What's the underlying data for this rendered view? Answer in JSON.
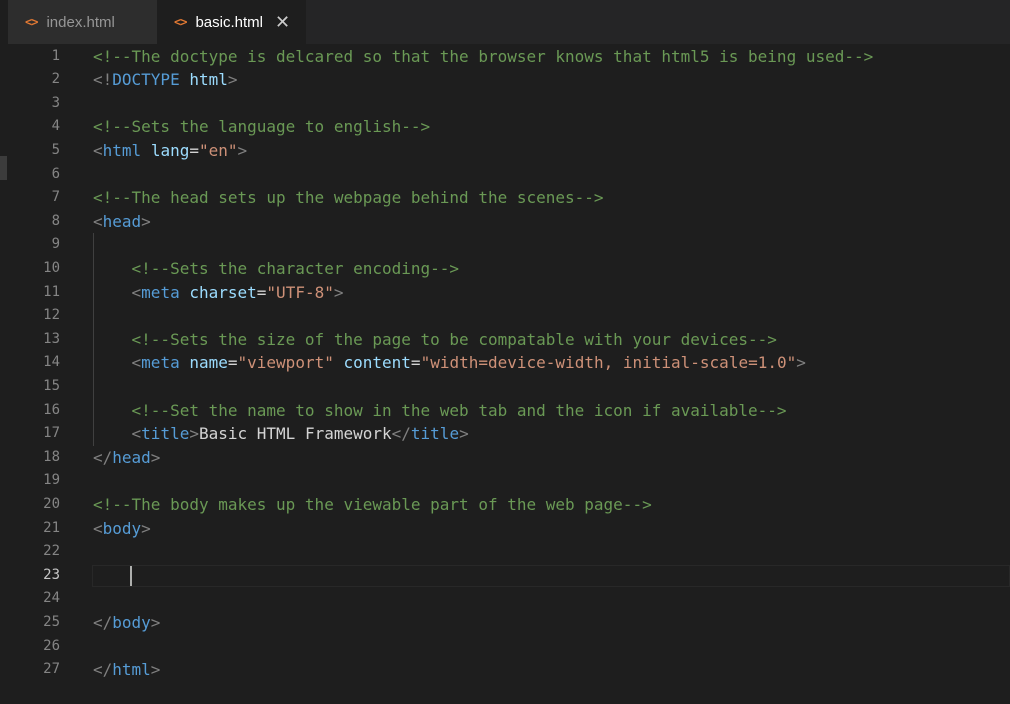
{
  "tabs": [
    {
      "label": "index.html",
      "icon": "html-file-icon",
      "active": false
    },
    {
      "label": "basic.html",
      "icon": "html-file-icon",
      "active": true,
      "close_glyph": "✕"
    }
  ],
  "tab_icon_glyph": "<>",
  "editor": {
    "current_line": 23,
    "line_numbers": [
      "1",
      "2",
      "3",
      "4",
      "5",
      "6",
      "7",
      "8",
      "9",
      "10",
      "11",
      "12",
      "13",
      "14",
      "15",
      "16",
      "17",
      "18",
      "19",
      "20",
      "21",
      "22",
      "23",
      "24",
      "25",
      "26",
      "27"
    ],
    "lines": [
      [
        {
          "t": "<!--The doctype is delcared so that the browser knows that html5 is being used-->",
          "c": "comment"
        }
      ],
      [
        {
          "t": "<!",
          "c": "punct"
        },
        {
          "t": "DOCTYPE",
          "c": "tag"
        },
        {
          "t": " ",
          "c": "text"
        },
        {
          "t": "html",
          "c": "attr"
        },
        {
          "t": ">",
          "c": "punct"
        }
      ],
      [],
      [
        {
          "t": "<!--Sets the language to english-->",
          "c": "comment"
        }
      ],
      [
        {
          "t": "<",
          "c": "punct"
        },
        {
          "t": "html",
          "c": "tag"
        },
        {
          "t": " ",
          "c": "text"
        },
        {
          "t": "lang",
          "c": "attr"
        },
        {
          "t": "=",
          "c": "text"
        },
        {
          "t": "\"en\"",
          "c": "str"
        },
        {
          "t": ">",
          "c": "punct"
        }
      ],
      [],
      [
        {
          "t": "<!--The head sets up the webpage behind the scenes-->",
          "c": "comment"
        }
      ],
      [
        {
          "t": "<",
          "c": "punct"
        },
        {
          "t": "head",
          "c": "tag"
        },
        {
          "t": ">",
          "c": "punct"
        }
      ],
      [],
      [
        {
          "t": "    ",
          "c": "text"
        },
        {
          "t": "<!--Sets the character encoding-->",
          "c": "comment"
        }
      ],
      [
        {
          "t": "    ",
          "c": "text"
        },
        {
          "t": "<",
          "c": "punct"
        },
        {
          "t": "meta",
          "c": "tag"
        },
        {
          "t": " ",
          "c": "text"
        },
        {
          "t": "charset",
          "c": "attr"
        },
        {
          "t": "=",
          "c": "text"
        },
        {
          "t": "\"UTF-8\"",
          "c": "str"
        },
        {
          "t": ">",
          "c": "punct"
        }
      ],
      [],
      [
        {
          "t": "    ",
          "c": "text"
        },
        {
          "t": "<!--Sets the size of the page to be compatable with your devices-->",
          "c": "comment"
        }
      ],
      [
        {
          "t": "    ",
          "c": "text"
        },
        {
          "t": "<",
          "c": "punct"
        },
        {
          "t": "meta",
          "c": "tag"
        },
        {
          "t": " ",
          "c": "text"
        },
        {
          "t": "name",
          "c": "attr"
        },
        {
          "t": "=",
          "c": "text"
        },
        {
          "t": "\"viewport\"",
          "c": "str"
        },
        {
          "t": " ",
          "c": "text"
        },
        {
          "t": "content",
          "c": "attr"
        },
        {
          "t": "=",
          "c": "text"
        },
        {
          "t": "\"width=device-width, initial-scale=1.0\"",
          "c": "str"
        },
        {
          "t": ">",
          "c": "punct"
        }
      ],
      [],
      [
        {
          "t": "    ",
          "c": "text"
        },
        {
          "t": "<!--Set the name to show in the web tab and the icon if available-->",
          "c": "comment"
        }
      ],
      [
        {
          "t": "    ",
          "c": "text"
        },
        {
          "t": "<",
          "c": "punct"
        },
        {
          "t": "title",
          "c": "tag"
        },
        {
          "t": ">",
          "c": "punct"
        },
        {
          "t": "Basic HTML Framework",
          "c": "text"
        },
        {
          "t": "</",
          "c": "punct"
        },
        {
          "t": "title",
          "c": "tag"
        },
        {
          "t": ">",
          "c": "punct"
        }
      ],
      [
        {
          "t": "</",
          "c": "punct"
        },
        {
          "t": "head",
          "c": "tag"
        },
        {
          "t": ">",
          "c": "punct"
        }
      ],
      [],
      [
        {
          "t": "<!--The body makes up the viewable part of the web page-->",
          "c": "comment"
        }
      ],
      [
        {
          "t": "<",
          "c": "punct"
        },
        {
          "t": "body",
          "c": "tag"
        },
        {
          "t": ">",
          "c": "punct"
        }
      ],
      [],
      [],
      [],
      [
        {
          "t": "</",
          "c": "punct"
        },
        {
          "t": "body",
          "c": "tag"
        },
        {
          "t": ">",
          "c": "punct"
        }
      ],
      [],
      [
        {
          "t": "</",
          "c": "punct"
        },
        {
          "t": "html",
          "c": "tag"
        },
        {
          "t": ">",
          "c": "punct"
        }
      ]
    ]
  },
  "colors": {
    "background": "#1e1e1e",
    "tab_bar": "#252526",
    "inactive_tab": "#2d2d2d",
    "html_icon": "#e37933",
    "comment": "#6a9955",
    "tag": "#569cd6",
    "attribute": "#9cdcfe",
    "string": "#ce9178",
    "punctuation": "#808080",
    "line_number": "#858585"
  }
}
